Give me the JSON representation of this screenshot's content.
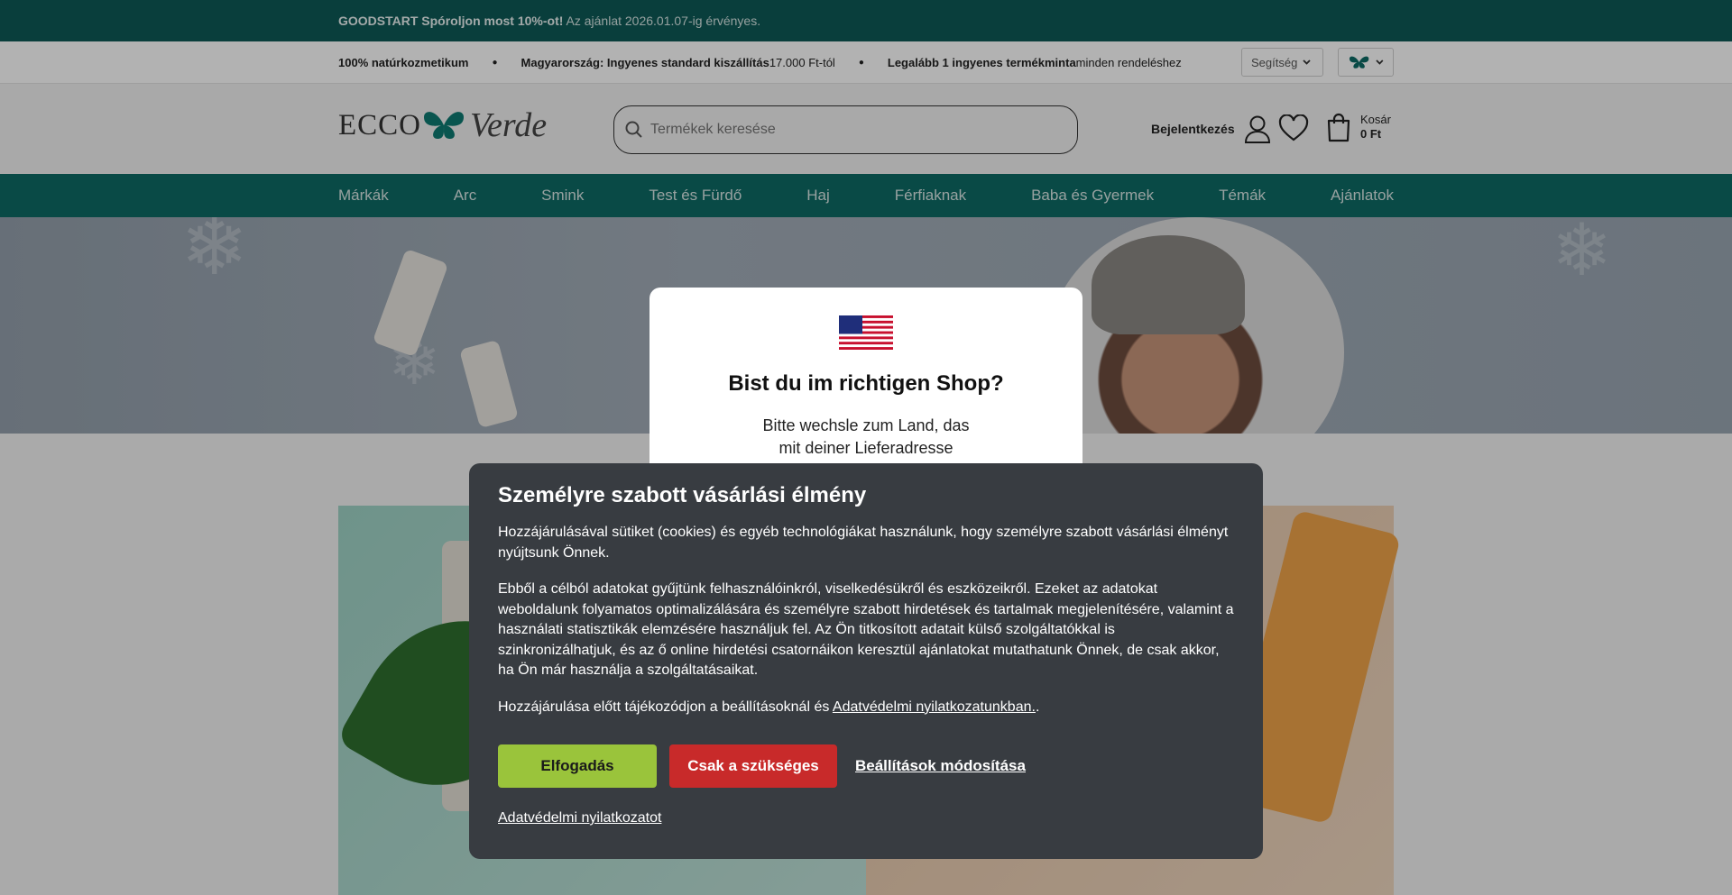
{
  "promo": {
    "bold": " GOODSTART  Spóroljon most 10%-ot!",
    "rest": " Az ajánlat 2026.01.07-ig érvényes.",
    "close": ""
  },
  "usp": [
    {
      "bold": "100% natúrkozmetikum",
      "rest": ""
    },
    {
      "bold": "Magyarország: Ingyenes standard kiszállítás",
      "rest": " 17.000 Ft-tól"
    },
    {
      "bold": "Legalább 1 ingyenes termékminta",
      "rest": " minden rendeléshez"
    }
  ],
  "help_select": "Segítség",
  "logo": {
    "left": "ECCO",
    "right": "Verde"
  },
  "search": {
    "placeholder": "Termékek keresése"
  },
  "account": {
    "login": "Bejelentkezés"
  },
  "cart": {
    "label": "Kosár",
    "total": "0 Ft"
  },
  "nav": [
    "Márkák",
    "Arc",
    "Smink",
    "Test és Fürdő",
    "Haj",
    "Férfiaknak",
    "Baba és Gyermek",
    "Témák",
    "Ajánlatok"
  ],
  "modal": {
    "close": "",
    "title": "Bist du im richtigen Shop?",
    "text_line1": "Bitte wechsle zum Land, das",
    "text_line2": "mit deiner Lieferadresse"
  },
  "cookie": {
    "title": "Személyre szabott vásárlási élmény",
    "p1": "Hozzájárulásával sütiket (cookies) és egyéb technológiákat használunk, hogy személyre szabott vásárlási élményt nyújtsunk Önnek.",
    "p2": "Ebből a célból adatokat gyűjtünk felhasználóinkról, viselkedésükről és eszközeikről. Ezeket az adatokat weboldalunk folyamatos optimalizálására és személyre szabott hirdetések és tartalmak megjelenítésére, valamint a használati statisztikák elemzésére használjuk fel. Az Ön titkosított adatait külső szolgáltatókkal is szinkronizálhatjuk, és az ő online hirdetési csatornáikon keresztül ajánlatokat mutathatunk Önnek, de csak akkor, ha Ön már használja a szolgáltatásaikat.",
    "p3_before": "Hozzájárulása előtt tájékozódjon a beállításoknál és ",
    "p3_link": "Adatvédelmi nyilatkozatunkban.",
    "p3_after": ".",
    "accept": "Elfogadás",
    "necessary": "Csak a szükséges",
    "settings": "Beállítások módosítása",
    "privacy": "Adatvédelmi nyilatkozatot"
  }
}
